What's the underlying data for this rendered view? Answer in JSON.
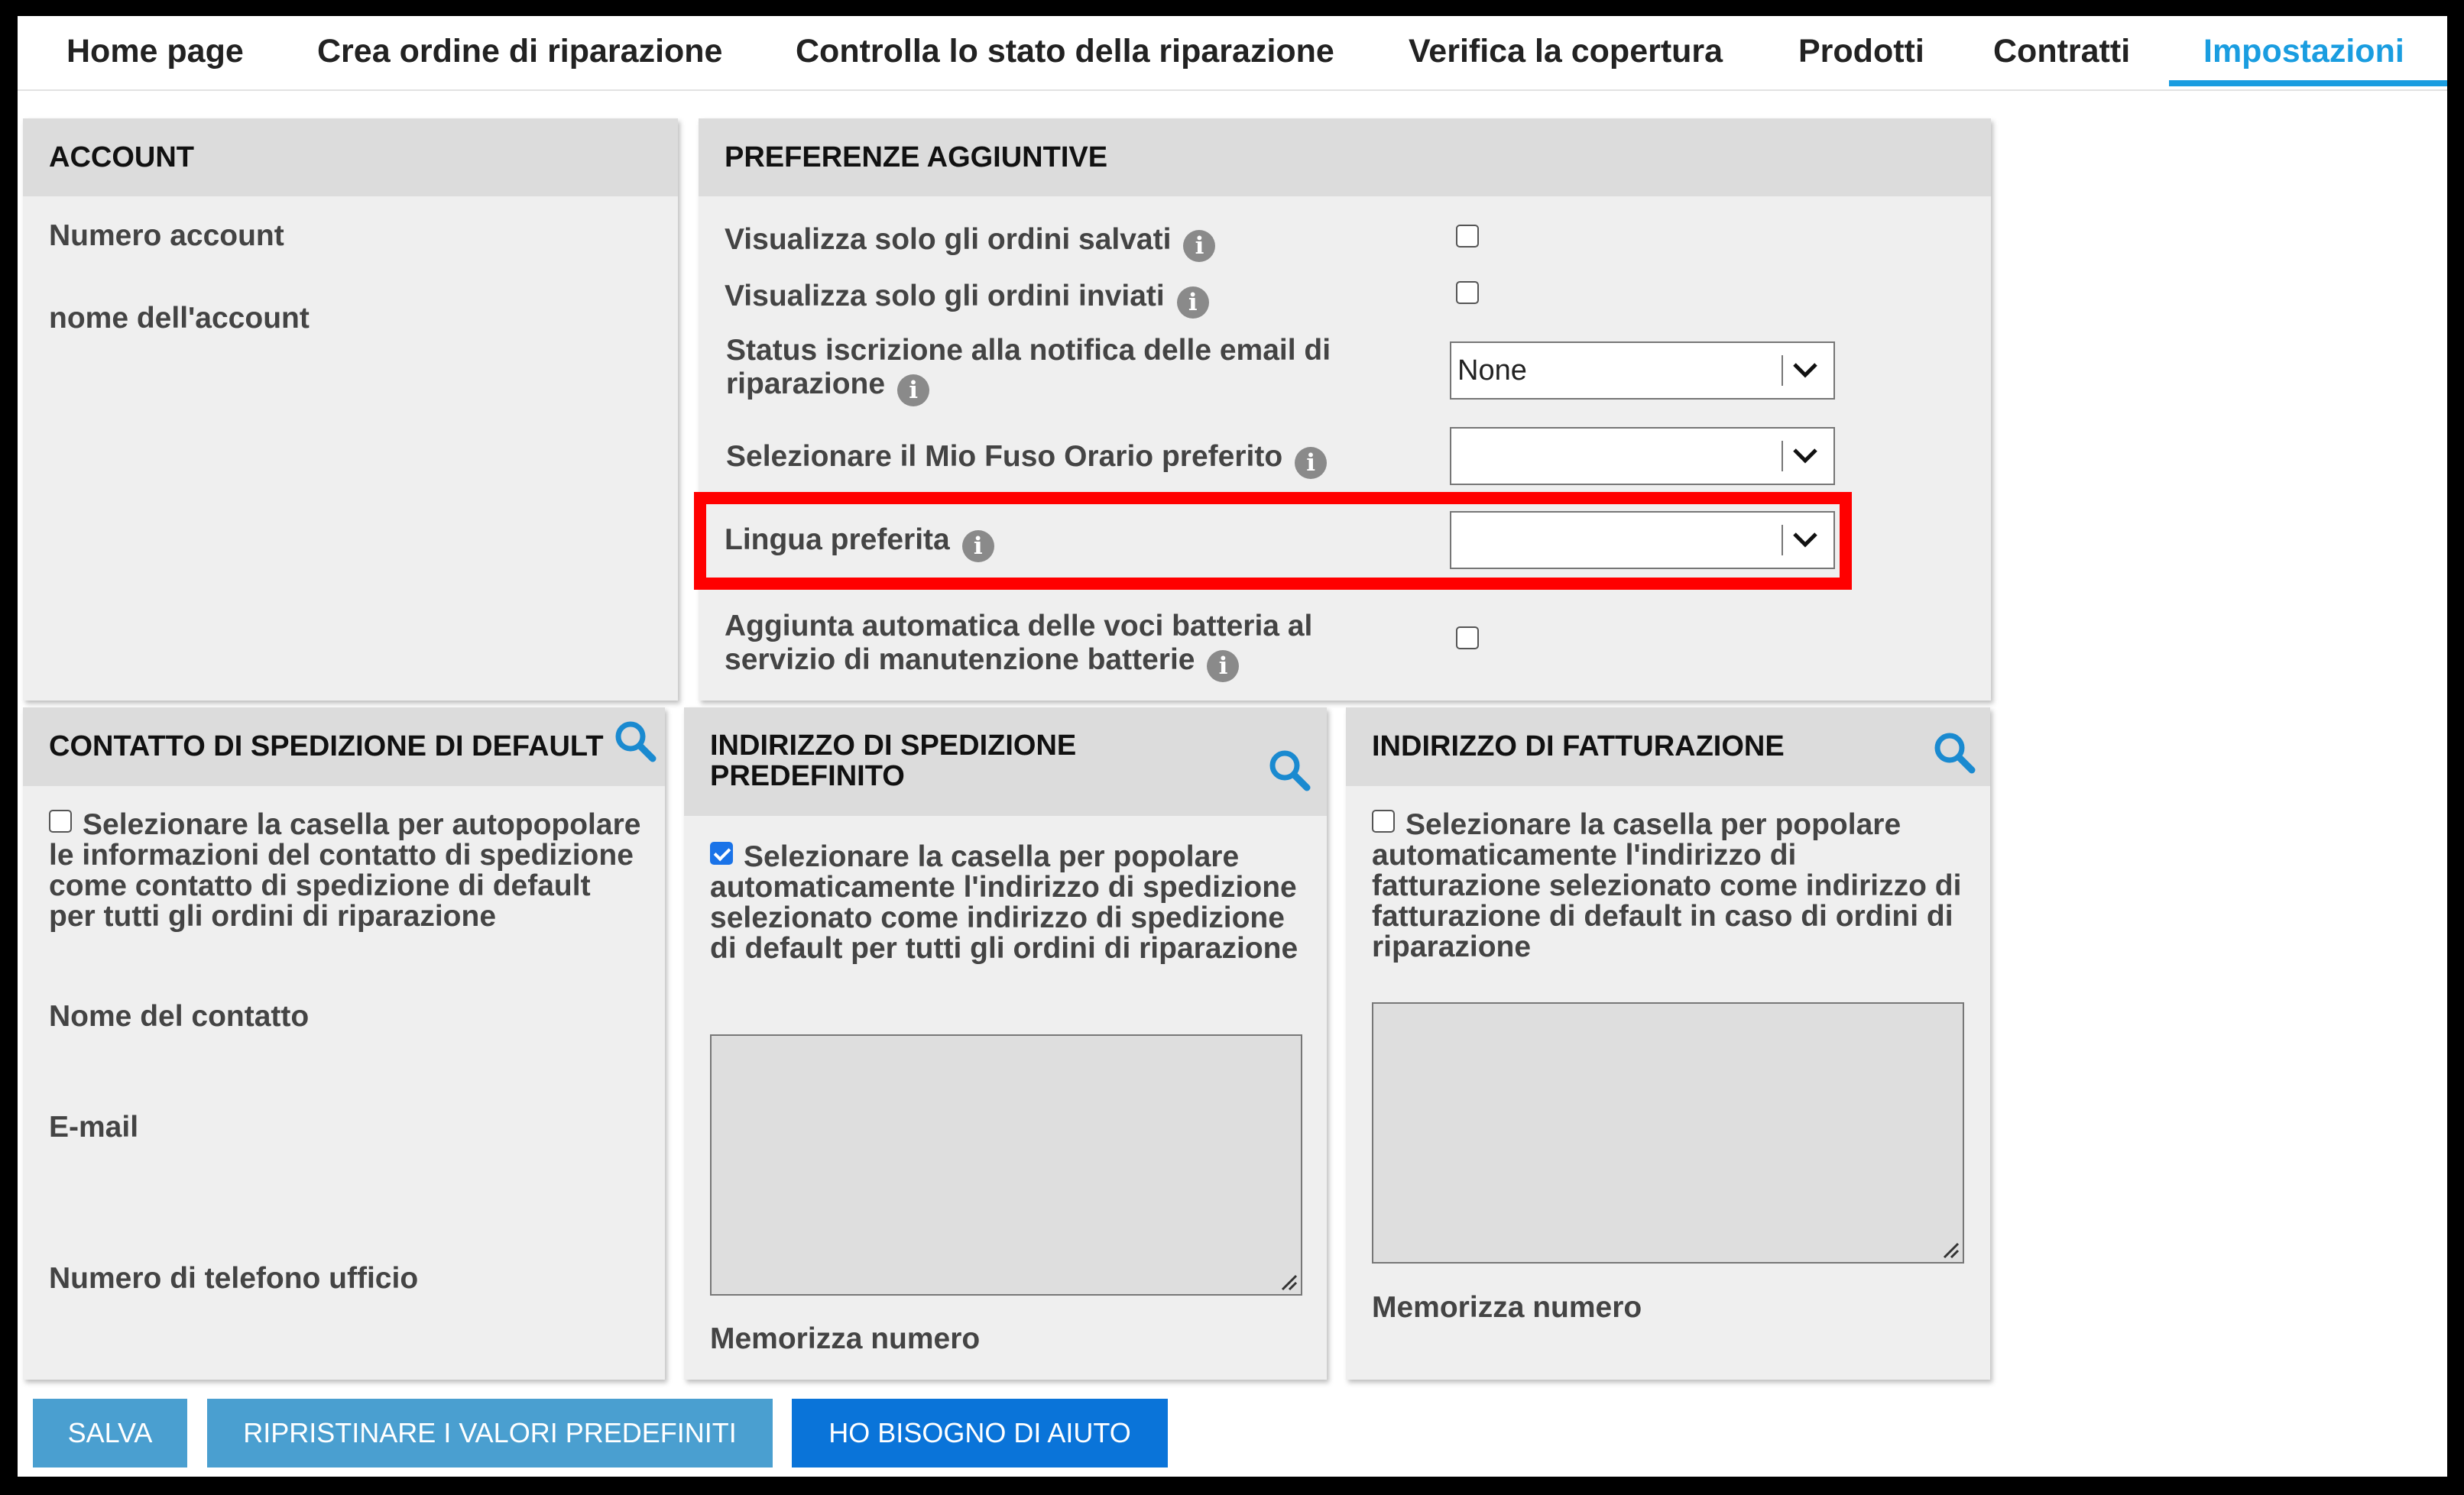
{
  "nav": {
    "tabs": [
      {
        "label": "Home page"
      },
      {
        "label": "Crea ordine di riparazione"
      },
      {
        "label": "Controlla lo stato della riparazione"
      },
      {
        "label": "Verifica la copertura"
      },
      {
        "label": "Prodotti"
      },
      {
        "label": "Contratti"
      },
      {
        "label": "Impostazioni",
        "active": true
      }
    ],
    "active_color": "#1a9de0"
  },
  "account": {
    "title": "ACCOUNT",
    "account_number_label": "Numero account",
    "account_name_label": "nome dell'account"
  },
  "preferences": {
    "title": "PREFERENZE AGGIUNTIVE",
    "saved_orders_label": "Visualizza solo gli ordini salvati",
    "saved_orders_checked": false,
    "sent_orders_label": "Visualizza solo gli ordini inviati",
    "sent_orders_checked": false,
    "email_status_label_line1": "Status iscrizione alla notifica delle email di",
    "email_status_label_line2": "riparazione",
    "email_status_value": "None",
    "timezone_label": "Selezionare il Mio Fuso Orario preferito",
    "timezone_value": "",
    "language_label": "Lingua preferita",
    "language_value": "",
    "battery_label_line1": "Aggiunta automatica delle voci batteria al",
    "battery_label_line2": "servizio di manutenzione batterie",
    "battery_checked": false
  },
  "shipping_contact": {
    "title": "CONTATTO DI SPEDIZIONE DI DEFAULT",
    "autofill_text": "Selezionare la casella per autopopolare le informazioni del contatto di spedizione come contatto di spedizione di default per tutti gli ordini di riparazione",
    "autofill_checked": false,
    "contact_name_label": "Nome del contatto",
    "email_label": "E-mail",
    "phone_label": "Numero di telefono ufficio"
  },
  "shipping_address": {
    "title_line1": "INDIRIZZO DI SPEDIZIONE",
    "title_line2": "PREDEFINITO",
    "autofill_text": "Selezionare la casella per popolare automaticamente l'indirizzo di spedizione selezionato come indirizzo di spedizione di default per tutti gli ordini di riparazione",
    "autofill_checked": true,
    "address_value": "",
    "memorize_label": "Memorizza numero"
  },
  "billing_address": {
    "title": "INDIRIZZO DI FATTURAZIONE",
    "autofill_text": "Selezionare la casella per popolare automaticamente l'indirizzo di fatturazione selezionato come indirizzo di fatturazione di default in caso di ordini di riparazione",
    "autofill_checked": false,
    "address_value": "",
    "memorize_label": "Memorizza numero"
  },
  "buttons": {
    "save": "SALVA",
    "reset": "RIPRISTINARE I VALORI PREDEFINITI",
    "help": "HO BISOGNO DI AIUTO",
    "secondary_color": "#4a9fd0",
    "primary_color": "#0a74d9"
  },
  "icons": {
    "info": "info-icon",
    "search": "search-icon",
    "dropdown": "chevron-down-icon"
  },
  "highlight_color": "#ff0000"
}
